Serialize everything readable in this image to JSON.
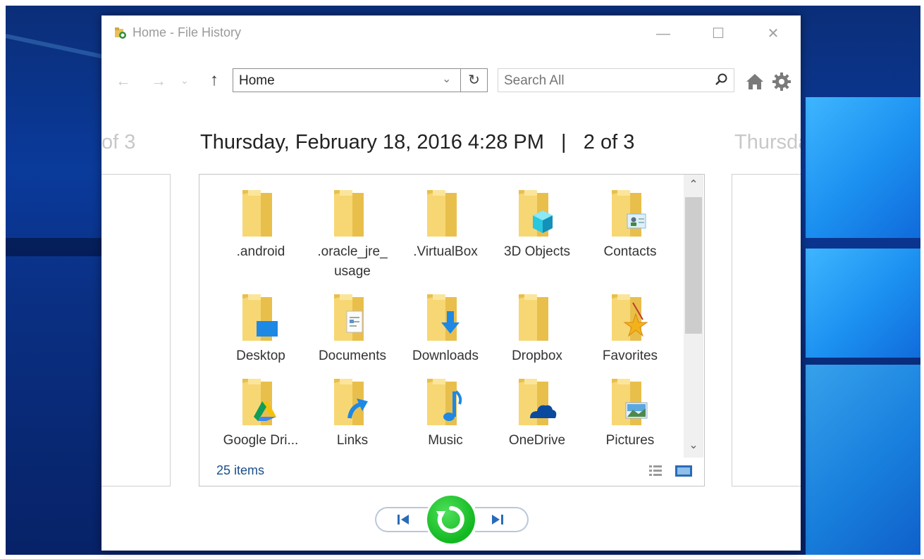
{
  "window": {
    "title": "Home - File History",
    "controls": {
      "minimize": "—",
      "maximize": "☐",
      "close": "✕"
    }
  },
  "toolbar": {
    "back": "←",
    "forward": "→",
    "recent": "⌄",
    "up": "↑",
    "location": "Home",
    "location_dropdown": "⌄",
    "refresh": "↻",
    "search_placeholder": "Search All"
  },
  "snapshots": {
    "previous_header": "of 3",
    "current_header": "Thursday, February 18, 2016 4:28 PM   |   2 of 3",
    "next_header": "Thursda"
  },
  "files": {
    "items": [
      {
        "label": ".android",
        "icon": "folder-icon"
      },
      {
        "label": ".oracle_jre_\nusage",
        "icon": "folder-icon"
      },
      {
        "label": ".VirtualBox",
        "icon": "folder-icon"
      },
      {
        "label": "3D Objects",
        "icon": "3d-objects-folder-icon"
      },
      {
        "label": "Contacts",
        "icon": "contacts-folder-icon"
      },
      {
        "label": "Desktop",
        "icon": "desktop-folder-icon"
      },
      {
        "label": "Documents",
        "icon": "documents-folder-icon"
      },
      {
        "label": "Downloads",
        "icon": "downloads-folder-icon"
      },
      {
        "label": "Dropbox",
        "icon": "folder-icon"
      },
      {
        "label": "Favorites",
        "icon": "favorites-folder-icon"
      },
      {
        "label": "Google Dri...",
        "icon": "google-drive-folder-icon"
      },
      {
        "label": "Links",
        "icon": "links-folder-icon"
      },
      {
        "label": "Music",
        "icon": "music-folder-icon"
      },
      {
        "label": "OneDrive",
        "icon": "onedrive-folder-icon"
      },
      {
        "label": "Pictures",
        "icon": "pictures-folder-icon"
      }
    ],
    "item_count": "25 items"
  },
  "scrollbar": {
    "up": "⌃",
    "down": "⌄"
  },
  "colors": {
    "folder": "#f7d774",
    "folder_dark": "#e9bf4c",
    "restore_green": "#17bf25",
    "link_text": "#1a4f8a"
  }
}
